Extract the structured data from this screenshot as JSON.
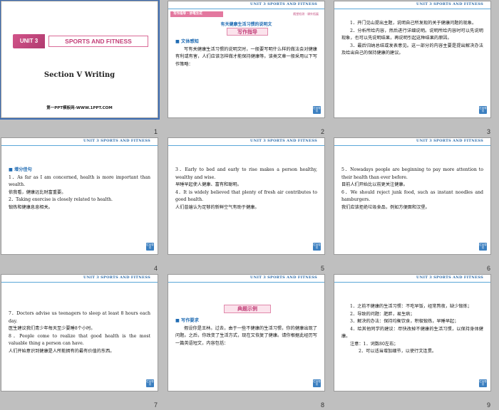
{
  "header_text": "UNIT 3   SPORTS AND FITNESS",
  "corner_button_label": "栏目导引",
  "slides": [
    {
      "number": "1",
      "unit_badge": "UNIT 3",
      "title": "SPORTS AND FITNESS",
      "section": "Section Ⅴ  Writing",
      "footer": "第一PPT模板网-WWW.1PPT.COM"
    },
    {
      "number": "2",
      "tab": "写作指导 · 妙笔生花",
      "tab_right": "随堂检测 · 课外拓展",
      "heading": "有关健康生活习惯的说明文",
      "box": "写作指导",
      "section_title": "文体感知",
      "body": "写有关健康生活习惯的说明文时，一般要写明什么样的做法会对健康有利或有害，人们应该怎样做才能保持健康等。该类文章一般采用以下写作策略："
    },
    {
      "number": "3",
      "items": [
        "1．开门见山提出主题，说明自己所发现的关于健康问题的现象。",
        "2．分析所给内容，然后进行详细说明。说明所给内容时可以先说明现象，也可以先说明结果，再说明引起这种结果的原因。",
        "3．最后归纳总结或发表意见。这一部分的内容主要是提出解决办法及给出自己的保持健康的建议。"
      ]
    },
    {
      "number": "4",
      "section_title": "增分佳句",
      "lines": [
        "1．As far as I am concerned, health is more important than wealth.",
        "依我看，健康远比财富重要。",
        "2．Taking exercise is closely related to health.",
        "锻炼和健康息息相关。"
      ]
    },
    {
      "number": "5",
      "lines": [
        "3．Early to bed and early to rise makes a person healthy, wealthy and wise.",
        "早睡早起使人健康、富有和聪明。",
        "4．It is widely believed that plenty of fresh air contributes to good health.",
        "人们普遍认为足够的新鲜空气有助于健康。"
      ]
    },
    {
      "number": "6",
      "lines": [
        "5．Nowadays people are beginning to pay more attention to their health than ever before.",
        "目前人们开始比以前更关注健康。",
        "6．We should reject junk food, such as instant noodles and hamburgers.",
        "我们应该拒绝垃圾食品，例如方便面和汉堡。"
      ]
    },
    {
      "number": "7",
      "lines": [
        "7．Doctors advise us teenagers to sleep at least 8 hours each day.",
        "医生建议我们青少年每天至少要睡8个小时。",
        "8．People come to realize that good health is the most valuable thing a person can have.",
        "人们开始意识到健康是人所能拥有的最有价值的东西。"
      ]
    },
    {
      "number": "8",
      "box": "典题示例",
      "section_title": "写作要求",
      "body": "假设你是王林。过去，由于一些不健康的生活习惯，你的健康出现了问题。之后，你改变了生活方式，现在又恢复了健康。请你根据此经历写一篇英语短文，内容包括："
    },
    {
      "number": "9",
      "items": [
        "1．之前不健康的生活习惯：不吃早饭，经常熬夜，缺少锻炼；",
        "2．导致的问题：肥胖，易生病；",
        "3．解决的办法：保持均衡饮食，积极锻炼，早睡早起；",
        "4．给其他同学的建议：尽快改掉不健康的生活习惯，以保持身体健康。",
        "注意：1．词数80左右；",
        "2．可以适当增加细节，以使行文连贯。"
      ]
    }
  ]
}
